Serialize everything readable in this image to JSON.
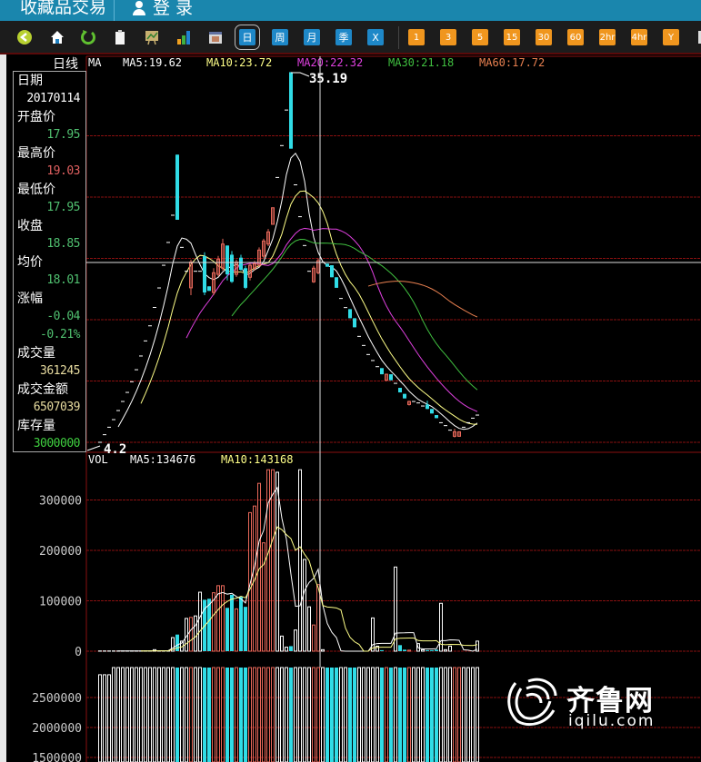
{
  "titlebar": {
    "app_name": "收藏品交易",
    "login": "登 录"
  },
  "toolbar": {
    "tools": [
      "back",
      "home",
      "refresh",
      "clipboard",
      "chart-picture",
      "bar-chart",
      "calendar"
    ],
    "periods": [
      "日",
      "周",
      "月",
      "季",
      "X"
    ],
    "minutes": [
      "1",
      "3",
      "5",
      "15",
      "30",
      "60",
      "2hr",
      "4hr",
      "Y"
    ],
    "selected_period": "日"
  },
  "chart_title": "日线",
  "info": {
    "date_label": "日期",
    "date": "20170114",
    "open_label": "开盘价",
    "open": "17.95",
    "high_label": "最高价",
    "high": "19.03",
    "low_label": "最低价",
    "low": "17.95",
    "close_label": "收盘",
    "close": "18.85",
    "avg_label": "均价",
    "avg": "18.01",
    "change_label": "涨幅",
    "change": "-0.04",
    "change_pct": "-0.21%",
    "volume_label": "成交量",
    "volume": "361245",
    "amount_label": "成交金额",
    "amount": "6507039",
    "inventory_label": "库存量",
    "inventory": "3000000"
  },
  "ma_legend": {
    "name": "MA",
    "ma5": "MA5:19.62",
    "ma10": "MA10:23.72",
    "ma20": "MA20:22.32",
    "ma30": "MA30:21.18",
    "ma60": "MA60:17.72"
  },
  "vol_legend": {
    "name": "VOL",
    "ma5": "MA5:134676",
    "ma10": "MA10:143168"
  },
  "colors": {
    "up": "#e8685a",
    "down": "#30dce6",
    "flat": "#ffffff",
    "ma5": "#ffffff",
    "ma10": "#ffff88",
    "ma20": "#e040e0",
    "ma30": "#40c040",
    "ma60": "#e88050",
    "grid": "#8a1010"
  },
  "watermark": {
    "name": "齐鲁网",
    "url": "iqilu.com"
  },
  "chart_data": {
    "type": "candlestick",
    "price_axis": {
      "gridlines": [
        5,
        10,
        15,
        20,
        25,
        30
      ],
      "max_label": "35.19",
      "min_label": "4.2"
    },
    "candles_ohlc": [
      [
        5.0,
        5.0,
        5.0,
        5.0
      ],
      [
        5.62,
        5.62,
        5.62,
        5.62
      ],
      [
        6.23,
        6.23,
        6.23,
        6.23
      ],
      [
        6.85,
        6.85,
        6.85,
        6.85
      ],
      [
        7.59,
        7.59,
        7.59,
        7.59
      ],
      [
        8.33,
        8.33,
        8.33,
        8.33
      ],
      [
        9.07,
        9.07,
        9.07,
        9.07
      ],
      [
        9.94,
        9.94,
        9.94,
        9.94
      ],
      [
        10.92,
        10.92,
        10.92,
        10.92
      ],
      [
        12.04,
        12.04,
        12.04,
        12.04
      ],
      [
        13.27,
        13.27,
        13.27,
        13.27
      ],
      [
        14.5,
        14.5,
        14.5,
        14.5
      ],
      [
        16.0,
        16.0,
        16.0,
        16.0
      ],
      [
        17.59,
        17.59,
        17.59,
        17.59
      ],
      [
        19.44,
        19.44,
        19.44,
        19.44
      ],
      [
        21.3,
        21.3,
        21.3,
        21.3
      ],
      [
        23.52,
        23.52,
        23.52,
        23.52
      ],
      [
        28.46,
        28.46,
        23.15,
        23.15
      ],
      [
        20.9,
        20.9,
        20.9,
        20.9
      ],
      [
        18.95,
        18.95,
        18.95,
        18.95
      ],
      [
        17.6,
        19.9,
        17.0,
        19.7
      ],
      [
        18.95,
        18.95,
        18.95,
        18.95
      ],
      [
        18.95,
        18.95,
        18.95,
        18.95
      ],
      [
        20.18,
        20.5,
        17.0,
        17.22
      ],
      [
        17.72,
        17.72,
        17.35,
        17.35
      ],
      [
        17.22,
        19.2,
        17.0,
        18.83
      ],
      [
        18.7,
        20.2,
        18.5,
        19.94
      ],
      [
        19.2,
        21.6,
        19.0,
        21.17
      ],
      [
        21.05,
        21.05,
        18.2,
        18.7
      ],
      [
        20.3,
        20.6,
        18.0,
        18.09
      ],
      [
        18.7,
        19.9,
        18.5,
        19.7
      ],
      [
        20.06,
        20.3,
        19.0,
        19.07
      ],
      [
        19.2,
        19.4,
        17.5,
        17.6
      ],
      [
        18.46,
        19.6,
        18.2,
        19.44
      ],
      [
        19.2,
        19.8,
        19.0,
        19.57
      ],
      [
        19.44,
        20.9,
        19.3,
        20.68
      ],
      [
        20.18,
        21.6,
        20.0,
        21.42
      ],
      [
        21.17,
        22.4,
        21.0,
        22.16
      ],
      [
        22.78,
        24.13,
        22.78,
        24.13
      ],
      [
        26.6,
        26.6,
        26.6,
        26.6
      ],
      [
        29.2,
        29.2,
        29.2,
        29.2
      ],
      [
        32.1,
        32.1,
        32.1,
        32.1
      ],
      [
        35.19,
        35.19,
        28.95,
        28.95
      ],
      [
        26.0,
        26.0,
        26.0,
        26.0
      ],
      [
        23.4,
        23.4,
        23.4,
        23.4
      ],
      [
        21.05,
        21.05,
        21.05,
        21.05
      ],
      [
        18.95,
        18.95,
        18.95,
        18.95
      ],
      [
        18.09,
        19.4,
        18.0,
        19.2
      ],
      [
        18.83,
        20.0,
        18.7,
        19.81
      ],
      [
        19.69,
        19.69,
        19.69,
        19.69
      ],
      [
        19.57,
        19.57,
        19.32,
        19.32
      ],
      [
        19.44,
        19.44,
        18.46,
        18.46
      ],
      [
        18.46,
        18.46,
        17.6,
        17.6
      ],
      [
        16.73,
        16.73,
        16.73,
        16.73
      ],
      [
        15.99,
        15.99,
        15.99,
        15.99
      ],
      [
        15.86,
        15.86,
        15.12,
        15.12
      ],
      [
        15.12,
        15.12,
        14.38,
        14.38
      ],
      [
        13.64,
        13.64,
        13.64,
        13.64
      ],
      [
        12.9,
        12.9,
        12.9,
        12.9
      ],
      [
        12.16,
        12.16,
        12.16,
        12.16
      ],
      [
        11.67,
        11.67,
        11.67,
        11.67
      ],
      [
        11.17,
        11.17,
        11.17,
        11.17
      ],
      [
        11.05,
        11.05,
        10.55,
        10.55
      ],
      [
        10.06,
        10.6,
        10.0,
        10.55
      ],
      [
        10.55,
        10.55,
        10.06,
        10.06
      ],
      [
        9.81,
        9.81,
        9.81,
        9.81
      ],
      [
        9.44,
        9.44,
        9.07,
        9.07
      ],
      [
        8.95,
        8.95,
        8.58,
        8.58
      ],
      [
        8.08,
        8.4,
        8.0,
        8.33
      ],
      [
        8.33,
        8.33,
        8.33,
        8.33
      ],
      [
        8.21,
        8.21,
        8.21,
        8.21
      ],
      [
        7.96,
        7.96,
        7.96,
        7.96
      ],
      [
        8.08,
        8.4,
        7.7,
        7.72
      ],
      [
        7.72,
        7.72,
        7.35,
        7.35
      ],
      [
        7.22,
        7.22,
        6.97,
        6.97
      ],
      [
        6.6,
        6.6,
        6.6,
        6.6
      ],
      [
        6.36,
        6.36,
        6.36,
        6.36
      ],
      [
        5.99,
        5.99,
        5.99,
        5.99
      ],
      [
        5.49,
        6.1,
        5.4,
        5.86
      ],
      [
        5.49,
        5.86,
        5.49,
        5.86
      ],
      [
        6.23,
        6.23,
        6.23,
        6.23
      ],
      [
        6.6,
        6.6,
        6.6,
        6.6
      ],
      [
        6.97,
        6.97,
        6.97,
        6.97
      ],
      [
        7.22,
        7.22,
        7.22,
        7.22
      ]
    ],
    "volume_axis": {
      "ticks": [
        "0",
        "100000",
        "200000",
        "300000"
      ],
      "values": [
        0,
        100000,
        200000,
        300000
      ]
    },
    "volumes": [
      500,
      500,
      500,
      500,
      500,
      500,
      500,
      500,
      500,
      500,
      500,
      500,
      3000,
      500,
      500,
      500,
      27000,
      33000,
      20000,
      65000,
      67000,
      70000,
      117000,
      102000,
      104000,
      116000,
      130000,
      130000,
      86000,
      112000,
      84000,
      108000,
      88000,
      275000,
      288000,
      333000,
      215000,
      360000,
      360000,
      355000,
      30000,
      8000,
      10000,
      42000,
      360000,
      182000,
      88000,
      52000,
      132000,
      3000,
      0,
      0,
      0,
      0,
      0,
      0,
      0,
      0,
      0,
      0,
      66000,
      10000,
      2000,
      0,
      0,
      167000,
      12000,
      3000,
      2000,
      0,
      15000,
      3000,
      2000,
      2000,
      3000,
      95000,
      3000,
      10000,
      0,
      0,
      0,
      0,
      0,
      20000
    ],
    "inventory_axis": {
      "ticks": [
        "2500000",
        "2000000",
        "1500000"
      ],
      "values": [
        2500000,
        2000000,
        1500000
      ]
    },
    "inventory": [
      2880000,
      2880000,
      2880000,
      3000000,
      3000000,
      3000000,
      3000000,
      3000000,
      3000000,
      3000000,
      3000000,
      3000000,
      3000000,
      3000000,
      3000000,
      3000000,
      3000000,
      3000000,
      3000000,
      3000000,
      3000000,
      3000000,
      3000000,
      3000000,
      3000000,
      3000000,
      3000000,
      3000000,
      3000000,
      3000000,
      3000000,
      3000000,
      3000000,
      3000000,
      3000000,
      3000000,
      3000000,
      3000000,
      3000000,
      3000000,
      3000000,
      3000000,
      3000000,
      3000000,
      3000000,
      3000000,
      3000000,
      3000000,
      3000000,
      3000000,
      3000000,
      3000000,
      3000000,
      3000000,
      3000000,
      3000000,
      3000000,
      3000000,
      3000000,
      3000000,
      3000000,
      3000000,
      3000000,
      3000000,
      3000000,
      3000000,
      3000000,
      3000000,
      3000000,
      3000000,
      3000000,
      3000000,
      3000000,
      3000000,
      3000000,
      3000000,
      3000000,
      3000000,
      3000000,
      3000000,
      3000000,
      3000000,
      3000000,
      3000000
    ],
    "crosshair_index": 49
  }
}
